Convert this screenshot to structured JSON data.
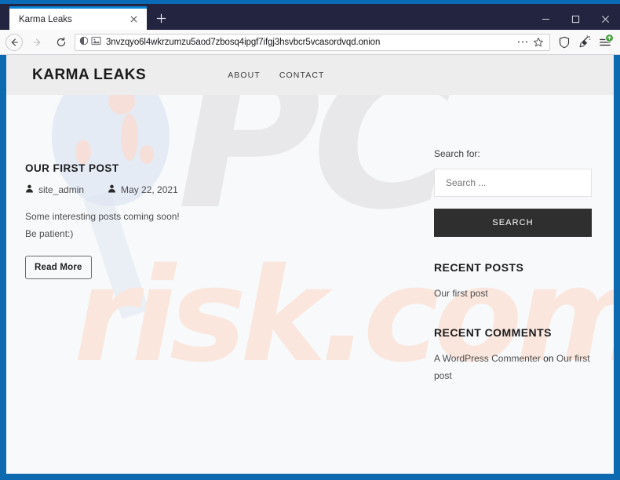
{
  "browser": {
    "tab": {
      "title": "Karma Leaks",
      "close_icon": "close-icon"
    },
    "new_tab_label": "+",
    "window_controls": {
      "minimize": "minimize-icon",
      "maximize": "maximize-icon",
      "close": "close-icon"
    },
    "toolbar": {
      "back_icon": "back-arrow-icon",
      "forward_icon": "forward-arrow-icon",
      "reload_icon": "reload-icon",
      "url": "3nvzqyo6l4wkrzumzu5aod7zbosq4ipgf7ifgj3hsvbcr5vcasordvqd.onion",
      "permissions_icon": "permissions-circle-icon",
      "page_icon": "image-placeholder-icon",
      "page_actions_icon": "ellipsis-icon",
      "bookmark_icon": "star-icon",
      "shield_icon": "shield-icon",
      "new_identity_icon": "broom-icon",
      "menu_icon": "hamburger-menu-icon",
      "download_badge_icon": "download-arrow-badge"
    }
  },
  "site": {
    "title": "KARMA LEAKS",
    "nav": [
      {
        "label": "ABOUT"
      },
      {
        "label": "CONTACT"
      }
    ],
    "post": {
      "title": "OUR FIRST POST",
      "author": "site_admin",
      "author_icon": "user-icon",
      "date": "May 22, 2021",
      "date_icon": "user-icon",
      "body_line1": "Some interesting posts coming soon!",
      "body_line2": "Be patient:)",
      "read_more_label": "Read More"
    },
    "sidebar": {
      "search": {
        "label": "Search for:",
        "placeholder": "Search ...",
        "value": "",
        "button_label": "SEARCH"
      },
      "recent_posts": {
        "title": "RECENT POSTS",
        "items": [
          {
            "label": "Our first post"
          }
        ]
      },
      "recent_comments": {
        "title": "RECENT COMMENTS",
        "items": [
          {
            "author": "A WordPress Commenter",
            "connector": "on",
            "post": "Our first post"
          }
        ]
      }
    },
    "watermark": {
      "primary": "PC",
      "secondary": "risk.com"
    }
  },
  "colors": {
    "titlebar": "#23243f",
    "accent_blue": "#0a6ab5",
    "window_border": "#0e6ab0",
    "tab_active": "#ffffff",
    "tab_highlight": "#0a84d8",
    "site_header_bg": "#ededee",
    "page_bg": "#f7f9fb",
    "search_button_bg": "#2f2f2f",
    "download_badge": "#3fa037",
    "watermark_primary": "#e8e8ea",
    "watermark_secondary": "#fae6dc"
  }
}
